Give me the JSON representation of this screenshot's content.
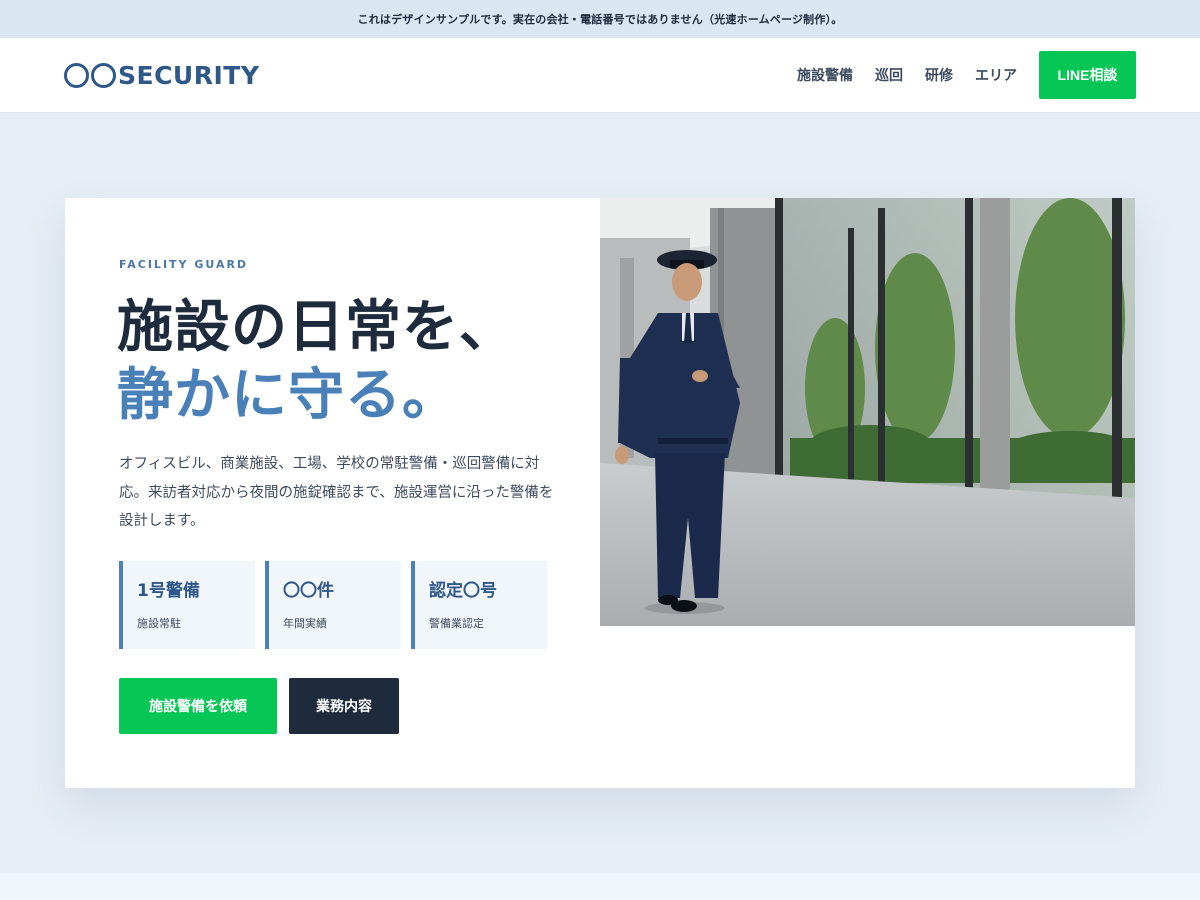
{
  "notice": "これはデザインサンプルです。実在の会社・電話番号ではありません（光速ホームページ制作）。",
  "logo": {
    "text": "SECURITY",
    "color": "#2f5889"
  },
  "nav": {
    "items": [
      {
        "label": "施設警備"
      },
      {
        "label": "巡回"
      },
      {
        "label": "研修"
      },
      {
        "label": "エリア"
      }
    ],
    "line_button": "LINE相談"
  },
  "hero": {
    "eyebrow": "FACILITY GUARD",
    "headline_line1": "施設の日常を、",
    "headline_line2": "静かに守る。",
    "lead": "オフィスビル、商業施設、工場、学校の常駐警備・巡回警備に対応。来訪者対応から夜間の施錠確認まで、施設運営に沿った警備を設計します。",
    "stats": [
      {
        "value": "1号警備",
        "label": "施設常駐"
      },
      {
        "value": "〇〇件",
        "label": "年間実績"
      },
      {
        "value": "認定〇号",
        "label": "警備業認定"
      }
    ],
    "cta_primary": "施設警備を依頼",
    "cta_secondary": "業務内容",
    "image_icon": "security-guard-photo"
  },
  "colors": {
    "accent_blue": "#4a80b8",
    "navy": "#1e2b3d",
    "line_green": "#06c755",
    "page_bg": "#e6edf5"
  }
}
